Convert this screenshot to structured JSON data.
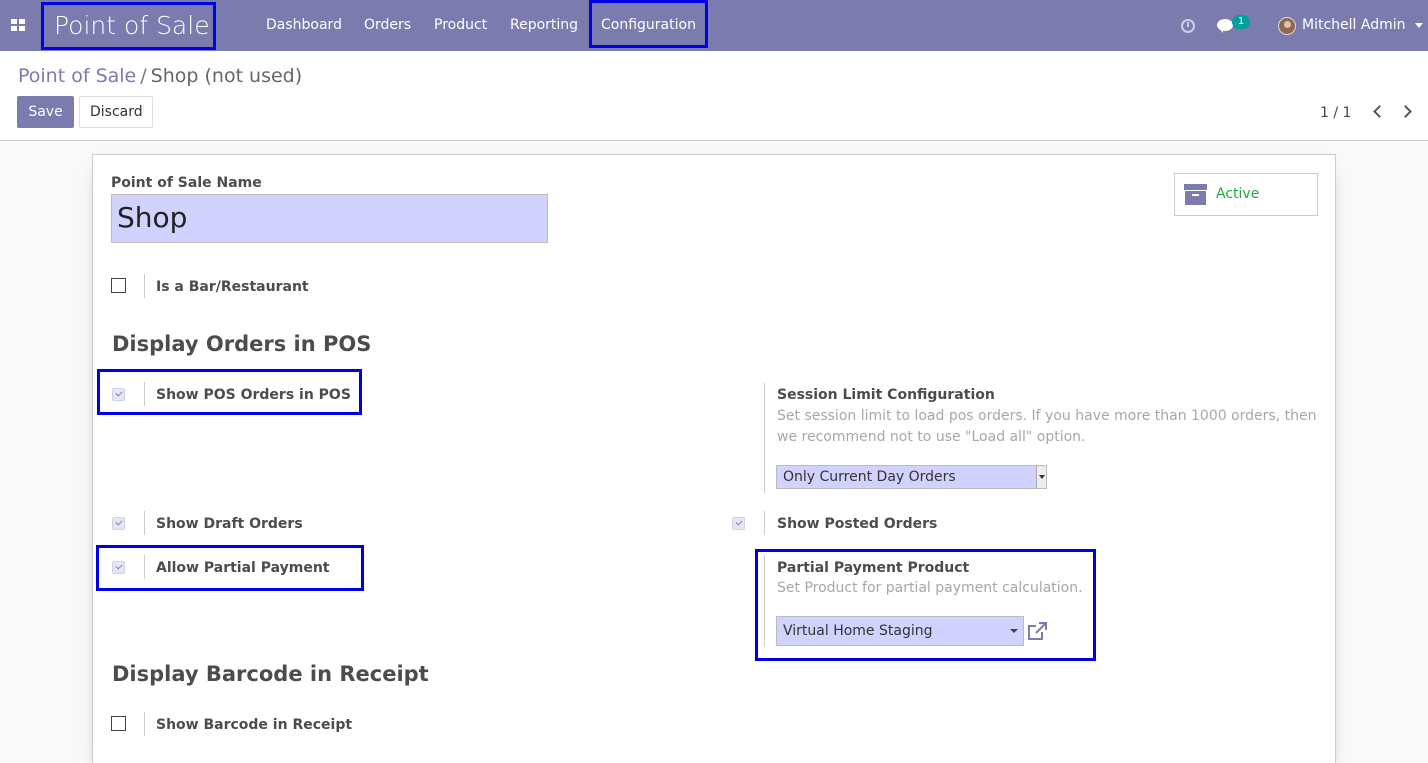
{
  "navbar": {
    "app_name": "Point of Sale",
    "menu": [
      "Dashboard",
      "Orders",
      "Product",
      "Reporting",
      "Configuration"
    ],
    "chat_count": "1",
    "user_name": "Mitchell Admin"
  },
  "breadcrumb": {
    "parent": "Point of Sale",
    "separator": "/",
    "current": "Shop (not used)"
  },
  "toolbar": {
    "save_label": "Save",
    "discard_label": "Discard",
    "pager": "1 / 1"
  },
  "form": {
    "name_label": "Point of Sale Name",
    "name_value": "Shop",
    "active_label": "Active",
    "is_bar_label": "Is a Bar/Restaurant",
    "is_bar_checked": false,
    "section_orders": "Display Orders in POS",
    "show_pos_orders_label": "Show POS Orders in POS",
    "show_pos_orders_checked": true,
    "session_limit_label": "Session Limit Configuration",
    "session_limit_help": "Set session limit to load pos orders. If you have more than 1000 orders, then we recommend not to use \"Load all\" option.",
    "session_limit_value": "Only Current Day Orders",
    "show_draft_label": "Show Draft Orders",
    "show_draft_checked": true,
    "show_posted_label": "Show Posted Orders",
    "show_posted_checked": true,
    "allow_partial_label": "Allow Partial Payment",
    "allow_partial_checked": true,
    "partial_product_label": "Partial Payment Product",
    "partial_product_help": "Set Product for partial payment calculation.",
    "partial_product_value": "Virtual Home Staging",
    "section_barcode": "Display Barcode in Receipt",
    "show_barcode_label": "Show Barcode in Receipt",
    "show_barcode_checked": false
  },
  "colors": {
    "brand": "#7c7bad",
    "highlight": "#0000e6",
    "active_green": "#28a745",
    "input_bg": "#d2d2ff"
  }
}
